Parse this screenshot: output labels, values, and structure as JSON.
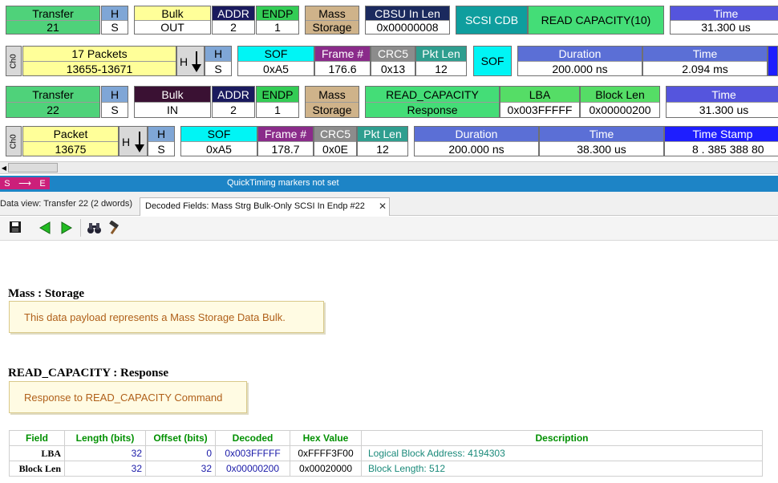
{
  "row1": {
    "transfer": {
      "label": "Transfer",
      "value": "21"
    },
    "h": {
      "label": "H",
      "value": "S"
    },
    "bulk": {
      "label": "Bulk",
      "value": "OUT"
    },
    "addr": {
      "label": "ADDR",
      "value": "2"
    },
    "endp": {
      "label": "ENDP",
      "value": "1"
    },
    "mass": {
      "label": "Mass",
      "value": "Storage"
    },
    "cbsu": {
      "label": "CBSU In Len",
      "value": "0x00000008"
    },
    "scsi": {
      "label": "SCSI CDB"
    },
    "readcap": {
      "label": "READ CAPACITY(10)"
    },
    "time": {
      "label": "Time",
      "value": "31.300 us"
    }
  },
  "row2": {
    "ch": "Ch0",
    "packets": {
      "label": "17 Packets",
      "value": "13655-13671"
    },
    "h": {
      "label": "H",
      "value": "S"
    },
    "sof": {
      "label": "SOF",
      "value": "0xA5"
    },
    "frame": {
      "label": "Frame #",
      "value": "176.6"
    },
    "crc5": {
      "label": "CRC5",
      "value": "0x13"
    },
    "pktlen": {
      "label": "Pkt Len",
      "value": "12"
    },
    "sof2": "SOF",
    "duration": {
      "label": "Duration",
      "value": "200.000 ns"
    },
    "time": {
      "label": "Time",
      "value": "2.094 ms"
    }
  },
  "row3": {
    "transfer": {
      "label": "Transfer",
      "value": "22"
    },
    "h": {
      "label": "H",
      "value": "S"
    },
    "bulk": {
      "label": "Bulk",
      "value": "IN"
    },
    "addr": {
      "label": "ADDR",
      "value": "2"
    },
    "endp": {
      "label": "ENDP",
      "value": "1"
    },
    "mass": {
      "label": "Mass",
      "value": "Storage"
    },
    "readcap": {
      "label": "READ_CAPACITY",
      "value": "Response"
    },
    "lba": {
      "label": "LBA",
      "value": "0x003FFFFF"
    },
    "blocklen": {
      "label": "Block Len",
      "value": "0x00000200"
    },
    "time": {
      "label": "Time",
      "value": "31.300 us"
    }
  },
  "row4": {
    "ch": "Ch0",
    "packet": {
      "label": "Packet",
      "value": "13675"
    },
    "h": {
      "label": "H",
      "value": "S"
    },
    "sof": {
      "label": "SOF",
      "value": "0xA5"
    },
    "frame": {
      "label": "Frame #",
      "value": "178.7"
    },
    "crc5": {
      "label": "CRC5",
      "value": "0x0E"
    },
    "pktlen": {
      "label": "Pkt Len",
      "value": "12"
    },
    "duration": {
      "label": "Duration",
      "value": "200.000 ns"
    },
    "time": {
      "label": "Time",
      "value": "38.300 us"
    },
    "timestamp": {
      "label": "Time Stamp",
      "value": "8 . 385 388 80"
    }
  },
  "status": {
    "markers": "S",
    "arrow": "⟶",
    "end": "E",
    "message": "QuickTiming markers not set"
  },
  "tabs": [
    {
      "label": "Data view: Transfer 22 (2 dwords)"
    },
    {
      "label": "Decoded Fields: Mass Strg Bulk-Only SCSI In Endp #22"
    }
  ],
  "tab_close": "✕",
  "section1": {
    "title": "Mass : Storage",
    "note": "This data payload represents a Mass Storage Data Bulk."
  },
  "section2": {
    "title": "READ_CAPACITY : Response",
    "note": "Response to READ_CAPACITY Command"
  },
  "table": {
    "headers": [
      "Field",
      "Length (bits)",
      "Offset (bits)",
      "Decoded",
      "Hex Value",
      "Description"
    ],
    "rows": [
      {
        "field": "LBA",
        "length": "32",
        "offset": "0",
        "decoded": "0x003FFFFF",
        "hex": "0xFFFF3F00",
        "desc": "Logical Block Address: 4194303"
      },
      {
        "field": "Block Len",
        "length": "32",
        "offset": "32",
        "decoded": "0x00000200",
        "hex": "0x00020000",
        "desc": "Block Length: 512"
      }
    ]
  },
  "colors": {
    "transfer_green": "#4fd27a",
    "h_blue": "#7fa6d6",
    "bulk_yellow": "#ffff99",
    "addr_navy": "#1a1a5e",
    "endp_green": "#33cc55",
    "mass_tan": "#cfb38a",
    "cbsu_navy": "#1b2a5e",
    "scsi_teal": "#0f9e9e",
    "readcap_green": "#44dd77",
    "time_blue": "#5555dd",
    "sof_cyan": "#00f5f5",
    "frame_purple": "#8a2b8a",
    "crc5_gray": "#8c8c8c",
    "pktlen_teal": "#2f9e8f",
    "duration_blue": "#5b6fd6",
    "timestamp_blue": "#1e1eff",
    "lba_green": "#55dd66"
  }
}
